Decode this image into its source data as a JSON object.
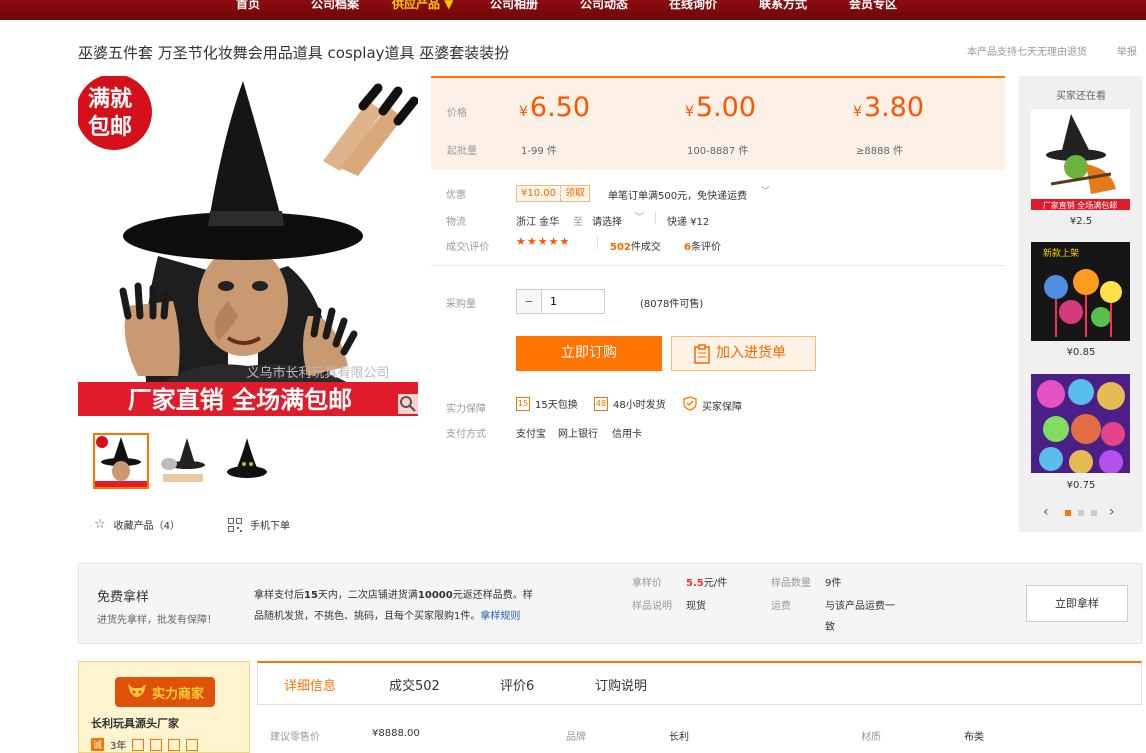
{
  "nav": {
    "items": [
      {
        "label": "首页",
        "active": false
      },
      {
        "label": "公司档案",
        "active": false
      },
      {
        "label": "供应产品 ▼",
        "active": true
      },
      {
        "label": "公司相册",
        "active": false
      },
      {
        "label": "公司动态",
        "active": false
      },
      {
        "label": "在线询价",
        "active": false
      },
      {
        "label": "联系方式",
        "active": false
      },
      {
        "label": "会员专区",
        "active": false
      }
    ]
  },
  "product": {
    "title": "巫婆五件套 万圣节化妆舞会用品道具 cosplay道具 巫婆套装装扮",
    "return_note": "本产品支持七天无理由退货",
    "report": "举报",
    "image_text": {
      "badge_line1": "满就",
      "badge_line2": "包邮",
      "watermark": "义乌市长利玩具有限公司",
      "banner": "厂家直销  全场满包邮"
    }
  },
  "pricing": {
    "price_label": "价格",
    "moq_label": "起批量",
    "currency": "¥",
    "tiers": [
      {
        "price": "6.50",
        "range": "1-99  件"
      },
      {
        "price": "5.00",
        "range": "100-8887  件"
      },
      {
        "price": "3.80",
        "range": "≥8888  件"
      }
    ]
  },
  "offers": {
    "promo_label": "优惠",
    "coupon_value": "¥10.00",
    "coupon_action": "领取",
    "promo_text": "单笔订单满500元，免快递运费",
    "logistics_label": "物流",
    "origin": "浙江 金华",
    "to": "至",
    "destination": "请选择",
    "shipping": "快递 ¥12",
    "deals_label": "成交\\评价",
    "sales_count": "502",
    "sales_suffix": "件成交",
    "review_count": "6",
    "review_suffix": "条评价",
    "rating": 4.5
  },
  "purchase": {
    "qty_label": "采购量",
    "qty_value": "1",
    "stock": "(8078件可售)",
    "order_button": "立即订购",
    "cart_button": "加入进货单",
    "guarantee_label": "实力保障",
    "guarantees": [
      "15天包换",
      "48小时发货",
      "买家保障"
    ],
    "payment_label": "支付方式",
    "payments": [
      "支付宝",
      "网上银行",
      "信用卡"
    ]
  },
  "gallery": {
    "favorite": "收藏产品（4）",
    "mobile": "手机下单"
  },
  "rail": {
    "title": "买家还在看",
    "items": [
      {
        "price": "¥2.5",
        "caption": "厂家直销  全场满包邮"
      },
      {
        "price": "¥0.85",
        "caption": "新款上架"
      },
      {
        "price": "¥0.75",
        "caption": ""
      }
    ],
    "dots": 3,
    "active_dot": 0
  },
  "sample": {
    "title": "免费拿样",
    "subtitle": "进货先拿样，批发有保障！",
    "desc_part1": "拿样支付后",
    "desc_days": "15",
    "desc_part2": "天内，二次店铺进货满",
    "desc_amount": "10000",
    "desc_part3": "元返还样品费。样",
    "desc_line2": "品随机发货，不挑色、挑码，且每个买家限购1件。",
    "rules_link": "拿样规则",
    "price_label": "拿样价",
    "price_value": "5.5",
    "price_unit": "元/件",
    "qty_label": "样品数量",
    "qty_value": "9件",
    "note_label": "样品说明",
    "note_value": "现货",
    "freight_label": "运费",
    "freight_value_line1": "与该产品运费一",
    "freight_value_line2": "致",
    "button": "立即拿样"
  },
  "supplier": {
    "badge": "实力商家",
    "name": "长利玩具源头厂家",
    "years": "3年"
  },
  "tabs": [
    {
      "label": "详细信息",
      "active": true
    },
    {
      "label": "成交502",
      "active": false
    },
    {
      "label": "评价6",
      "active": false
    },
    {
      "label": "订购说明",
      "active": false
    }
  ],
  "details": {
    "retail_label": "建议零售价",
    "retail_value": "¥8888.00",
    "brand_label": "品牌",
    "brand_value": "长利",
    "material_label": "材质",
    "material_value": "布类"
  },
  "colors": {
    "accent": "#ff7300",
    "price": "#ff5500",
    "nav": "#7a080b"
  }
}
